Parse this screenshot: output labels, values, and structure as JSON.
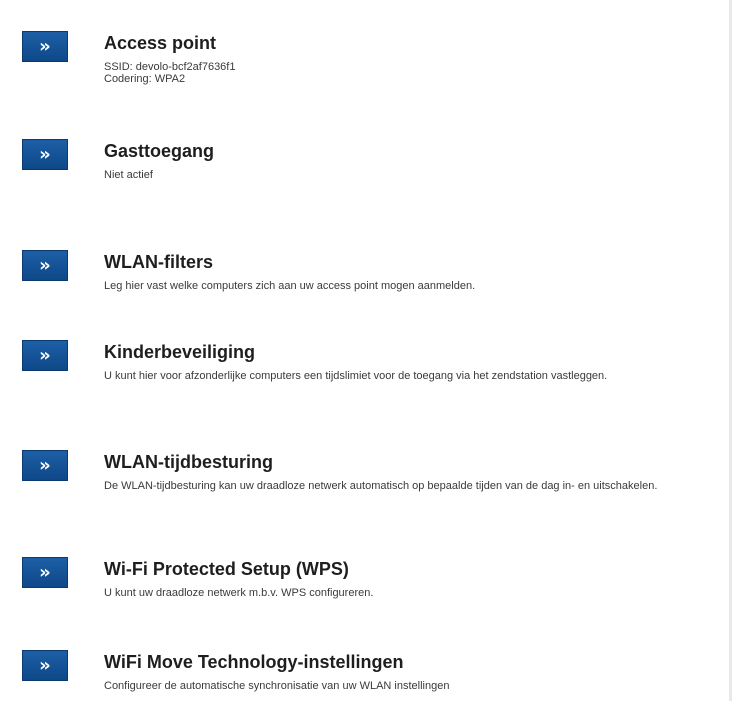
{
  "menu": {
    "items": [
      {
        "title": "Access point",
        "description_lines": [
          "SSID: devolo-bcf2af7636f1",
          "Codering: WPA2"
        ]
      },
      {
        "title": "Gasttoegang",
        "description_lines": [
          "Niet actief"
        ]
      },
      {
        "title": "WLAN-filters",
        "description_lines": [
          "Leg hier vast welke computers zich aan uw access point mogen aanmelden."
        ]
      },
      {
        "title": "Kinderbeveiliging",
        "description": "U kunt hier voor afzonderlijke computers een tijdslimiet voor de toegang via het zendstation vastleggen."
      },
      {
        "title": "WLAN-tijdbesturing",
        "description": "De WLAN-tijdbesturing kan uw draadloze netwerk automatisch op bepaalde tijden van de dag in- en uitschakelen."
      },
      {
        "title": "Wi-Fi Protected Setup (WPS)",
        "description_lines": [
          "U kunt uw draadloze netwerk m.b.v. WPS configureren."
        ]
      },
      {
        "title": "WiFi Move Technology-instellingen",
        "description_lines": [
          "Configureer de automatische synchronisatie van uw WLAN instellingen"
        ]
      }
    ],
    "button_glyph": "»",
    "button_icon": "double-chevron-right-icon",
    "accent_color": "#15569b"
  }
}
